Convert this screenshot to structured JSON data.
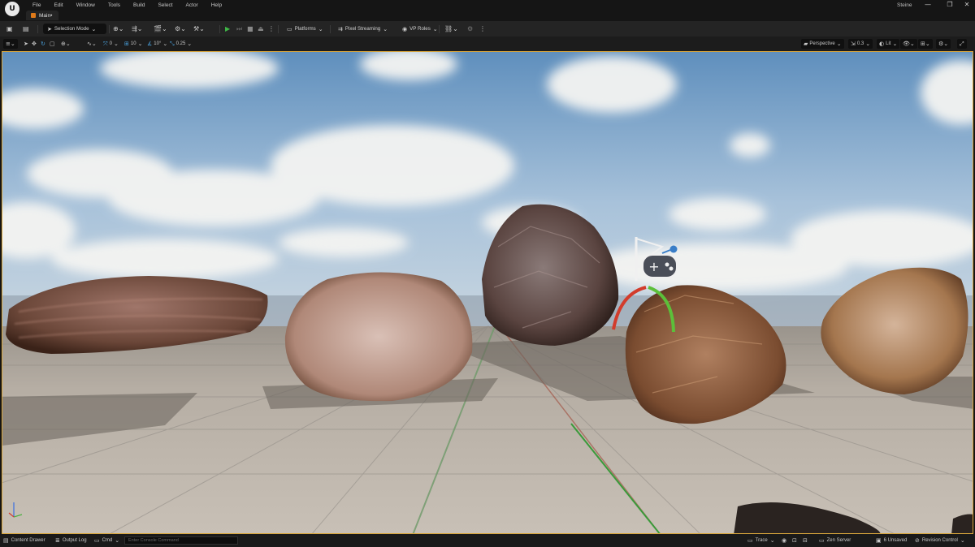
{
  "app": {
    "logo_text": "U",
    "menu": [
      "File",
      "Edit",
      "Window",
      "Tools",
      "Build",
      "Select",
      "Actor",
      "Help"
    ],
    "level_tab": "Main•",
    "user": "Steine",
    "window_controls": [
      "—",
      "❐",
      "✕"
    ]
  },
  "toolbar": {
    "selection_mode": "Selection Mode",
    "platforms": "Platforms",
    "pixel_streaming": "Pixel Streaming",
    "vp_roles": "VP Roles"
  },
  "viewport_toolbar": {
    "rotation_snap_value": "0",
    "grid_snap_value": "10",
    "angle_snap_value": "10°",
    "scale_snap_value": "0.25",
    "perspective": "Perspective",
    "fov_value": "0.3",
    "view_mode": "Lit"
  },
  "statusbar": {
    "content_drawer": "Content Drawer",
    "output_log": "Output Log",
    "cmd": "Cmd",
    "console_placeholder": "Enter Console Command",
    "trace": "Trace",
    "zen_server": "Zen Server",
    "unsaved": "6 Unsaved",
    "revision_control": "Revision Control"
  },
  "colors": {
    "accent_orange": "#e07b1a",
    "play_green": "#3fb847",
    "viewport_border": "#d7a53c",
    "snap_blue": "#4aa3e0"
  },
  "scene": {
    "objects": [
      "rock-1",
      "rock-2",
      "rock-3",
      "rock-4",
      "rock-5"
    ],
    "gizmo": "player-start-icon"
  }
}
